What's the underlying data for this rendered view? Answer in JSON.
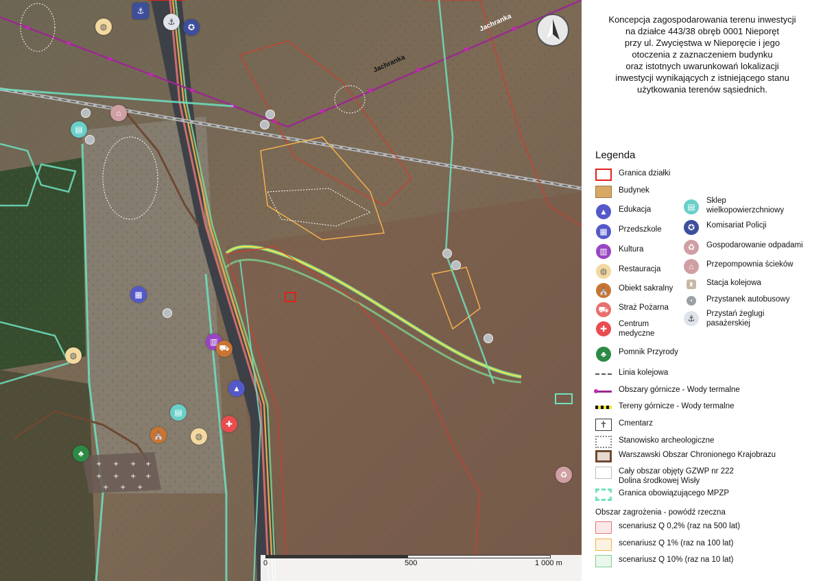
{
  "title_lines": [
    "Koncepcja zagospodarowania terenu inwestycji",
    "na działce 443/38 obręb 0001 Nieporęt",
    "przy ul. Zwycięstwa w Nieporęcie i jego",
    "otoczenia z zaznaczeniem budynku",
    "oraz istotnych uwarunkowań lokalizacji",
    "inwestycji wynikających z istniejącego stanu",
    "użytkowania terenów sąsiednich."
  ],
  "legend": {
    "heading": "Legenda",
    "granica": "Granica działki",
    "budynek": "Budynek",
    "edukacja": "Edukacja",
    "przedszkole": "Przedszkole",
    "kultura": "Kultura",
    "restauracja": "Restauracja",
    "sakralny": "Obiekt sakralny",
    "straz": "Straż Pożarna",
    "medyczne_1": "Centrum",
    "medyczne_2": "medyczne",
    "pomnik": "Pomnik Przyrody",
    "sklep_1": "Sklep",
    "sklep_2": "wielkopowierzchniowy",
    "policja": "Komisariat Policji",
    "odpady": "Gospodarowanie odpadami",
    "sciekow": "Przepompownia ścieków",
    "kolejowa_stacja": "Stacja kolejowa",
    "autobus": "Przystanek autobusowy",
    "zegluga_1": "Przystań żeglugi",
    "zegluga_2": "pasażerskiej",
    "linia_kolejowa": "Linia kolejowa",
    "obszary_gornicze": "Obszary górnicze - Wody termalne",
    "tereny_gornicze": "Tereny górnicze - Wody termalne",
    "cmentarz": "Cmentarz",
    "archeo": "Stanowisko archeologiczne",
    "wochk": "Warszawski Obszar Chronionego Krajobrazu",
    "gzwp_1": "Cały obszar objęty GZWP nr 222",
    "gzwp_2": "Dolina środkowej Wisły",
    "mpzp": "Granica obowiązującego MPZP",
    "powodz_head": "Obszar zagrożenia - powódź rzeczna",
    "q02": "scenariusz Q 0,2% (raz na 500 lat)",
    "q1": "scenariusz Q 1% (raz na 100 lat)",
    "q10": "scenariusz Q 10% (raz na 10 lat)"
  },
  "scale": {
    "t0": "0",
    "t500": "500",
    "t1000": "1 000 m"
  },
  "road_labels": {
    "a": "Jachranka",
    "b": "Jachranka"
  },
  "colors": {
    "granica": "#e32119",
    "budynek": "#d8a865",
    "edukacja": "#5459c9",
    "kultura": "#9a45c2",
    "restauracja": "#f3d9a0",
    "sakralny": "#c87533",
    "straz": "#e8706c",
    "medyczne": "#e84c4f",
    "pomnik": "#2c8a45",
    "sklep": "#68cfc9",
    "policja": "#3d4f9c",
    "odpady": "#cf9fa4",
    "mpzp": "#6fe0c0",
    "q02": "#e57777",
    "q1": "#f3b04b",
    "q10": "#7fd08c",
    "wochk": "#6d4832"
  }
}
